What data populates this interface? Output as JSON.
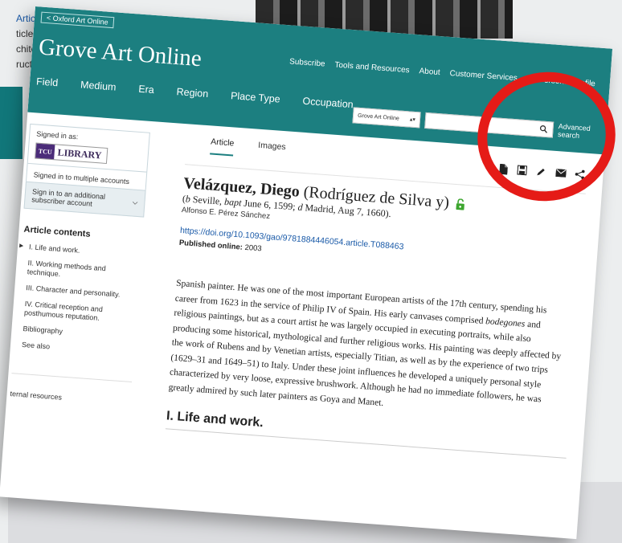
{
  "background": {
    "fragment_lines": [
      "Article",
      "ticles",
      "chite",
      "ructu"
    ]
  },
  "header": {
    "oxford_link": "< Oxford Art Online",
    "brand": "Grove Art Online",
    "top_links": [
      "Subscribe",
      "Tools and Resources",
      "About",
      "Customer Services",
      "|",
      "Personal Profile"
    ],
    "nav": [
      "Field",
      "Medium",
      "Era",
      "Region",
      "Place Type",
      "Occupation"
    ],
    "search": {
      "scope": "Grove Art Online",
      "placeholder": "",
      "advanced": "Advanced search"
    }
  },
  "sidebar": {
    "signed_in_label": "Signed in as:",
    "library_logo_tcu": "TCU",
    "library_logo_text": "LIBRARY",
    "multiple_accounts": "Signed in to multiple accounts",
    "sign_in_additional": "Sign in to an additional subscriber account",
    "contents_title": "Article contents",
    "toc": [
      "I. Life and work.",
      "II. Working methods and technique.",
      "III. Character and personality.",
      "IV. Critical reception and posthumous reputation.",
      "Bibliography",
      "See also"
    ],
    "external": "ternal resources"
  },
  "main": {
    "tabs": [
      "Article",
      "Images"
    ],
    "tool_icons": [
      "file-icon",
      "save-icon",
      "pencil-icon",
      "email-icon",
      "share-icon"
    ],
    "title_bold": "Velázquez, Diego",
    "title_rest": "(Rodríguez de Silva y)",
    "lifespan_b": "b",
    "lifespan_1": " Seville, ",
    "lifespan_bapt": "bapt",
    "lifespan_2": " June 6, 1599; ",
    "lifespan_d": "d",
    "lifespan_3": " Madrid, Aug 7, 1660).",
    "author": "Alfonso E. Pérez Sánchez",
    "doi": "https://doi.org/10.1093/gao/9781884446054.article.T088463",
    "published_label": "Published online:",
    "published_year": "2003",
    "paragraph_1": "Spanish painter. He was one of the most important European artists of the 17th century, spending his career from 1623 in the service of Philip IV of Spain. His early canvases comprised ",
    "paragraph_em": "bodegones",
    "paragraph_2": " and religious paintings, but as a court artist he was largely occupied in executing portraits, while also producing some historical, mythological and further religious works. His painting was deeply affected by the work of Rubens and by Venetian artists, especially Titian, as well as by the experience of two trips (1629–31 and 1649–51) to Italy. Under these joint influences he developed a uniquely personal style characterized by very loose, expressive brushwork. Although he had no immediate followers, he was greatly admired by such later painters as Goya and Manet.",
    "section_heading": "I. Life and work."
  },
  "colors": {
    "teal": "#1c7f80",
    "annotation_ring": "#e51b17",
    "link": "#1a5aa8"
  }
}
